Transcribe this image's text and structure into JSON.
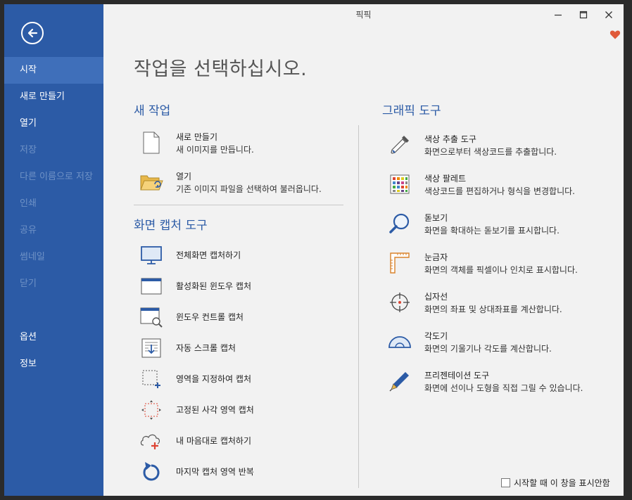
{
  "window": {
    "title": "픽픽"
  },
  "sidebar": {
    "items": [
      {
        "label": "시작"
      },
      {
        "label": "새로 만들기"
      },
      {
        "label": "열기"
      },
      {
        "label": "저장"
      },
      {
        "label": "다른 이름으로 저장"
      },
      {
        "label": "인쇄"
      },
      {
        "label": "공유"
      },
      {
        "label": "썸네일"
      },
      {
        "label": "닫기"
      },
      {
        "label": "옵션"
      },
      {
        "label": "정보"
      }
    ]
  },
  "main": {
    "heading": "작업을 선택하십시오.",
    "new_task": {
      "title": "새 작업",
      "items": [
        {
          "title": "새로 만들기",
          "desc": "새 이미지를 만듭니다."
        },
        {
          "title": "열기",
          "desc": "기존 이미지 파일을 선택하여 불러옵니다."
        }
      ]
    },
    "capture": {
      "title": "화면 캡처 도구",
      "items": [
        {
          "title": "전체화면 캡처하기"
        },
        {
          "title": "활성화된 윈도우 캡처"
        },
        {
          "title": "윈도우 컨트롤 캡처"
        },
        {
          "title": "자동 스크롤 캡처"
        },
        {
          "title": "영역을 지정하여 캡처"
        },
        {
          "title": "고정된 사각 영역 캡처"
        },
        {
          "title": "내 마음대로 캡처하기"
        },
        {
          "title": "마지막 캡처 영역 반복"
        }
      ]
    },
    "graphic": {
      "title": "그래픽 도구",
      "items": [
        {
          "title": "색상 추출 도구",
          "desc": "화면으로부터 색상코드를 추출합니다."
        },
        {
          "title": "색상 팔레트",
          "desc": "색상코드를 편집하거나 형식을 변경합니다."
        },
        {
          "title": "돋보기",
          "desc": "화면을 확대하는 돋보기를 표시합니다."
        },
        {
          "title": "눈금자",
          "desc": "화면의 객체를 픽셀이나 인치로 표시합니다."
        },
        {
          "title": "십자선",
          "desc": "화면의 좌표 및 상대좌표를 계산합니다."
        },
        {
          "title": "각도기",
          "desc": "화면의 기울기나 각도를 계산합니다."
        },
        {
          "title": "프리젠테이션 도구",
          "desc": "화면에 선이나 도형을 직접 그릴 수 있습니다."
        }
      ]
    },
    "footer": {
      "checkbox_label": "시작할 때 이 창을 표시안함"
    }
  },
  "colors": {
    "sidebar": "#2c5ba6",
    "sidebar_active": "#3f6fba",
    "accent_text": "#2c5ba6",
    "heart": "#e05a3a"
  }
}
